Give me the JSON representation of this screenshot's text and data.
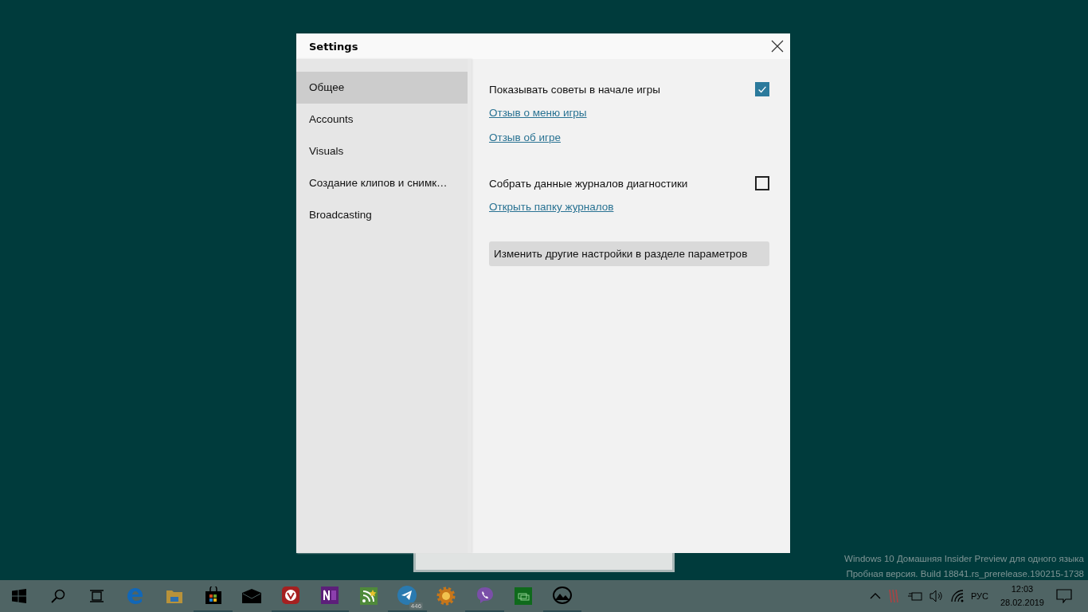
{
  "window": {
    "title": "Settings"
  },
  "sidebar": {
    "items": [
      {
        "label": "Общее",
        "selected": true
      },
      {
        "label": "Accounts",
        "selected": false
      },
      {
        "label": "Visuals",
        "selected": false
      },
      {
        "label": "Создание клипов и снимк…",
        "selected": false
      },
      {
        "label": "Broadcasting",
        "selected": false
      }
    ]
  },
  "content": {
    "items": [
      {
        "kind": "checkbox",
        "label": "Показывать советы в начале игры",
        "checked": true
      },
      {
        "kind": "link",
        "label": "Отзыв о меню игры"
      },
      {
        "kind": "link",
        "label": "Отзыв об игре"
      },
      {
        "kind": "checkbox",
        "label": "Собрать данные журналов диагностики",
        "checked": false
      },
      {
        "kind": "link",
        "label": "Открыть папку журналов"
      },
      {
        "kind": "button",
        "label": "Изменить другие настройки в разделе параметров"
      }
    ]
  },
  "desktop_text": [
    "Windows 10 Домашняя Insider Preview для одного языка",
    "Пробная версия. Build 18841.rs_prerelease.190215-1738"
  ],
  "taskbar": {
    "apps": [
      {
        "kind": "start",
        "running": false
      },
      {
        "kind": "search",
        "running": false
      },
      {
        "kind": "taskview",
        "running": false
      },
      {
        "kind": "edge",
        "running": false
      },
      {
        "kind": "folder",
        "running": false
      },
      {
        "kind": "store",
        "running": true
      },
      {
        "kind": "mail",
        "running": false
      },
      {
        "kind": "vivaldi",
        "running": true
      },
      {
        "kind": "onenote",
        "running": true
      },
      {
        "kind": "feed",
        "running": false
      },
      {
        "kind": "telegram",
        "running": true,
        "badge": "446"
      },
      {
        "kind": "gear",
        "running": false
      },
      {
        "kind": "viber",
        "running": true
      },
      {
        "kind": "green",
        "running": false
      },
      {
        "kind": "photos",
        "running": true
      }
    ],
    "language": "РУС",
    "time": "12:03",
    "date": "28.02.2019"
  }
}
